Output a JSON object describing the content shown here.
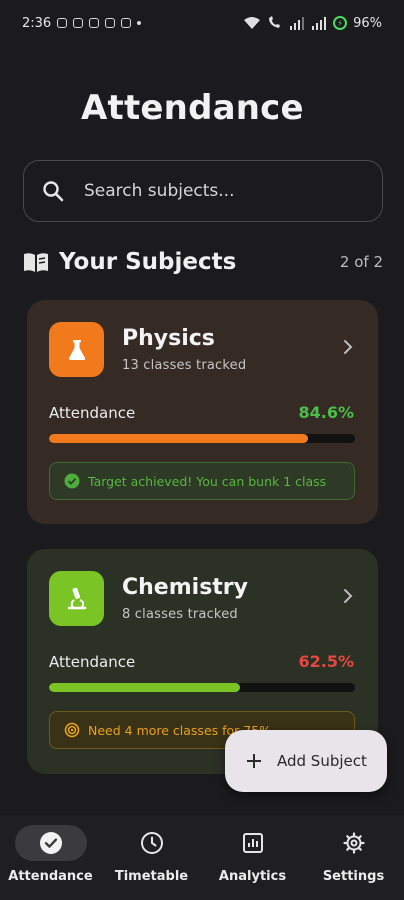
{
  "status_bar": {
    "time": "2:36",
    "battery": "96%"
  },
  "header": {
    "title": "Attendance"
  },
  "search": {
    "placeholder": "Search subjects..."
  },
  "section": {
    "title": "Your Subjects",
    "count": "2 of 2"
  },
  "subjects": [
    {
      "name": "Physics",
      "classes": "13 classes tracked",
      "attendance_label": "Attendance",
      "attendance": "84.6%",
      "progress": 0.846,
      "color": "#f07a1c",
      "value_color": "#4cbf4a",
      "note": "Target achieved! You can bunk 1 class",
      "icon": "flask-icon"
    },
    {
      "name": "Chemistry",
      "classes": "8 classes tracked",
      "attendance_label": "Attendance",
      "attendance": "62.5%",
      "progress": 0.625,
      "color": "#7bc425",
      "value_color": "#e5483f",
      "note": "Need 4 more classes for 75%",
      "icon": "microscope-icon"
    }
  ],
  "fab": {
    "label": "Add Subject"
  },
  "nav": [
    {
      "label": "Attendance",
      "icon": "check-circle-icon",
      "active": true
    },
    {
      "label": "Timetable",
      "icon": "clock-icon",
      "active": false
    },
    {
      "label": "Analytics",
      "icon": "chart-icon",
      "active": false
    },
    {
      "label": "Settings",
      "icon": "gear-icon",
      "active": false
    }
  ]
}
